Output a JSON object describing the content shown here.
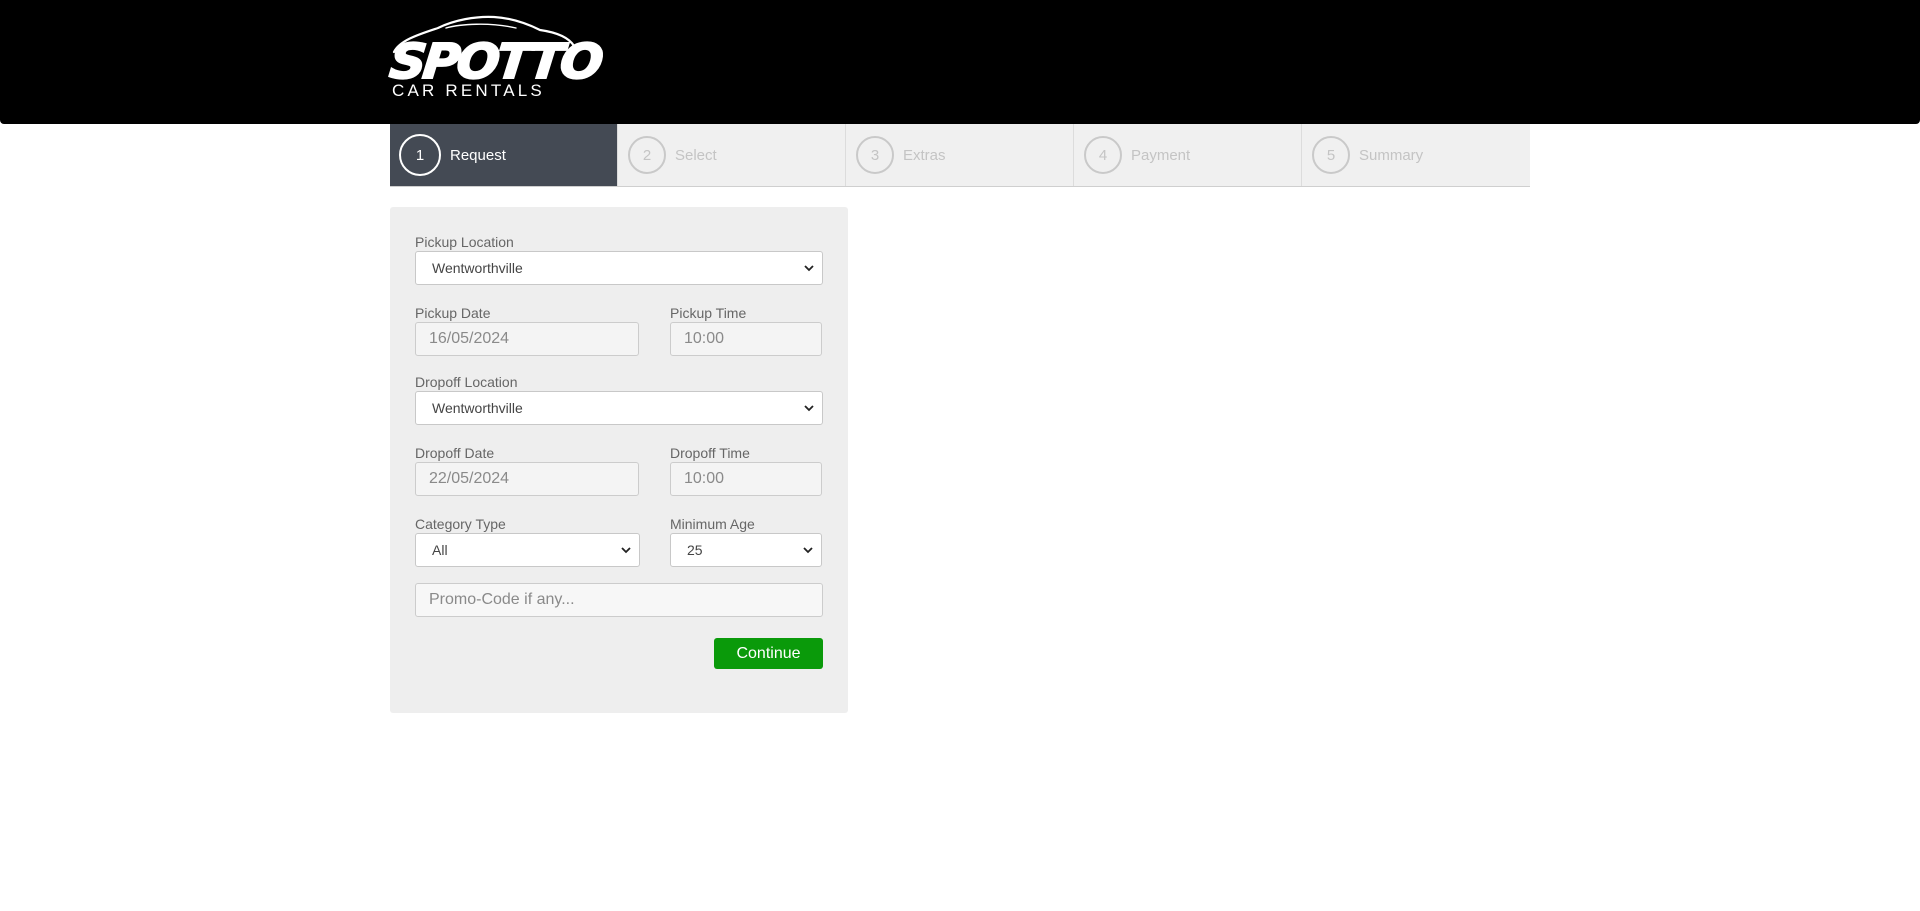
{
  "brand": {
    "name": "SPOTTO",
    "tagline": "CAR RENTALS"
  },
  "steps": [
    {
      "number": "1",
      "label": "Request",
      "active": true
    },
    {
      "number": "2",
      "label": "Select",
      "active": false
    },
    {
      "number": "3",
      "label": "Extras",
      "active": false
    },
    {
      "number": "4",
      "label": "Payment",
      "active": false
    },
    {
      "number": "5",
      "label": "Summary",
      "active": false
    }
  ],
  "form": {
    "pickup_location": {
      "label": "Pickup Location",
      "value": "Wentworthville"
    },
    "pickup_date": {
      "label": "Pickup Date",
      "value": "16/05/2024"
    },
    "pickup_time": {
      "label": "Pickup Time",
      "value": "10:00"
    },
    "dropoff_location": {
      "label": "Dropoff Location",
      "value": "Wentworthville"
    },
    "dropoff_date": {
      "label": "Dropoff Date",
      "value": "22/05/2024"
    },
    "dropoff_time": {
      "label": "Dropoff Time",
      "value": "10:00"
    },
    "category_type": {
      "label": "Category Type",
      "value": "All"
    },
    "minimum_age": {
      "label": "Minimum Age",
      "value": "25"
    },
    "promo_code": {
      "placeholder": "Promo-Code if any..."
    },
    "continue_label": "Continue"
  },
  "colors": {
    "header_bg": "#000000",
    "active_step_bg": "#444a54",
    "continue_bg": "#0a9a0a",
    "panel_bg": "#eeeeee"
  },
  "icons": {
    "select_arrow": "chevron-down-icon",
    "logo_car": "car-outline-icon"
  }
}
